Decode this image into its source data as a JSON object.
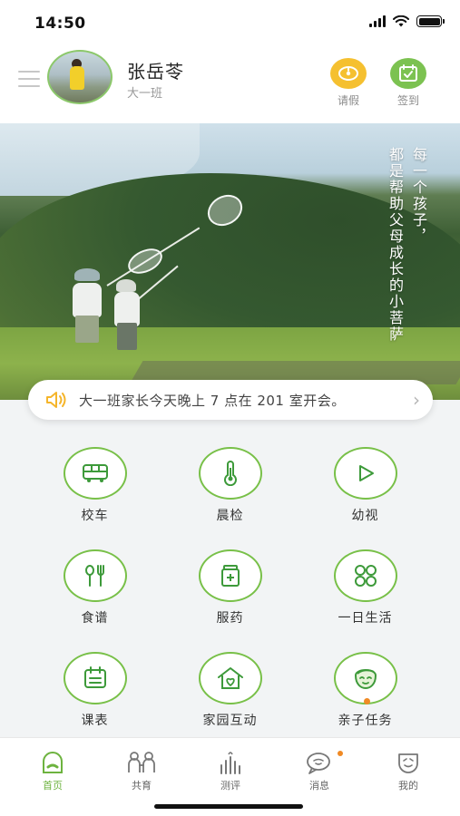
{
  "status_bar": {
    "time": "14:50"
  },
  "header": {
    "user_name": "张岳苓",
    "class_name": "大一班",
    "actions": [
      {
        "label": "请假",
        "icon": "leave-request-icon",
        "color": "#f5c030"
      },
      {
        "label": "签到",
        "icon": "calendar-checkin-icon",
        "color": "#7cc251"
      }
    ]
  },
  "banner": {
    "poem_lines": [
      "每一个孩子，",
      "都是帮助父母成长的小菩萨"
    ]
  },
  "notice": {
    "text": "大一班家长今天晚上 7 点在 201 室开会。",
    "icon": "speaker-icon"
  },
  "features": [
    {
      "label": "校车",
      "icon": "bus-icon"
    },
    {
      "label": "晨检",
      "icon": "thermometer-icon"
    },
    {
      "label": "幼视",
      "icon": "play-icon"
    },
    {
      "label": "食谱",
      "icon": "utensils-icon"
    },
    {
      "label": "服药",
      "icon": "medicine-icon"
    },
    {
      "label": "一日生活",
      "icon": "clover-icon"
    },
    {
      "label": "课表",
      "icon": "timetable-icon"
    },
    {
      "label": "家园互动",
      "icon": "home-heart-icon"
    },
    {
      "label": "亲子任务",
      "icon": "child-face-icon"
    }
  ],
  "tabs": [
    {
      "label": "首页",
      "icon": "home-tab-icon",
      "active": true
    },
    {
      "label": "共育",
      "icon": "co-parenting-icon",
      "active": false
    },
    {
      "label": "测评",
      "icon": "assessment-icon",
      "active": false
    },
    {
      "label": "消息",
      "icon": "message-icon",
      "active": false,
      "badge": true
    },
    {
      "label": "我的",
      "icon": "profile-icon",
      "active": false
    }
  ],
  "colors": {
    "accent_green": "#78c048",
    "badge_orange": "#f08a24",
    "tab_active": "#6db33f"
  }
}
